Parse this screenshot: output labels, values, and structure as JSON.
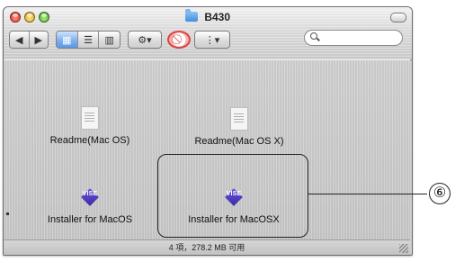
{
  "window": {
    "title": "B430",
    "status_text": "4 項，278.2 MB 可用"
  },
  "toolbar": {
    "back_forward": [
      "◀",
      "▶"
    ],
    "view_modes": [
      "▦",
      "☰",
      "▥"
    ],
    "action_label": "⚙▾",
    "burn_symbol": "⃠",
    "arrange_label": "⋮▾",
    "search_placeholder": ""
  },
  "items": [
    {
      "label": "Readme(Mac OS)",
      "icon": "document-icon"
    },
    {
      "label": "Readme(Mac OS X)",
      "icon": "document-icon"
    },
    {
      "label": "Installer for MacOS",
      "icon": "vise-installer-icon",
      "icon_text": "VISE"
    },
    {
      "label": "Installer for MacOSX",
      "icon": "vise-installer-icon",
      "icon_text": "VISE"
    }
  ],
  "annotation": {
    "callout_number": "⑥"
  },
  "colors": {
    "accent": "#5a97e6",
    "vise": "#4b3bbf"
  }
}
